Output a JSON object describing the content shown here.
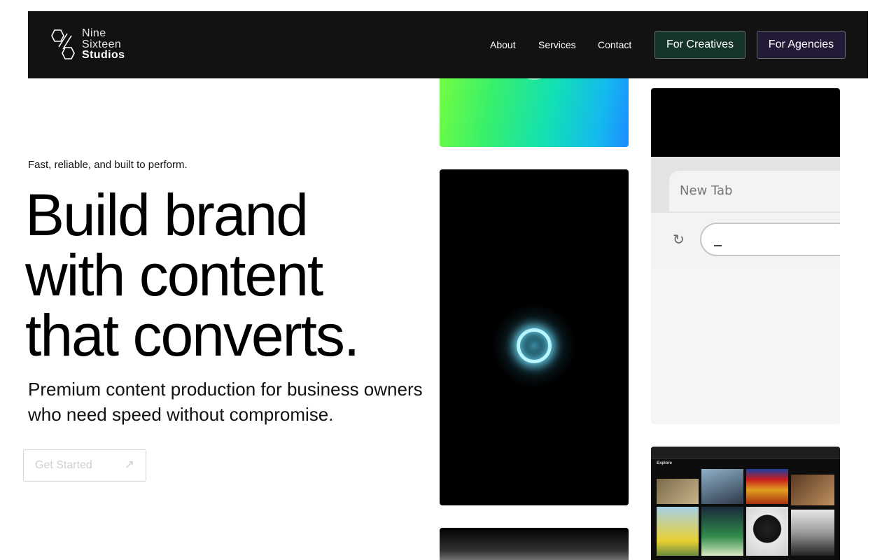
{
  "brand": {
    "logo_icon": "hexagon-logo-icon",
    "name_line1": "Nine",
    "name_line2": "Sixteen",
    "name_line3": "Studios"
  },
  "nav": {
    "links": [
      "About",
      "Services",
      "Contact"
    ],
    "creatives_button": "For Creatives",
    "agencies_button": "For Agencies",
    "creatives_color": "#15342c",
    "agencies_color": "#221a37",
    "background": "#121212"
  },
  "hero": {
    "tagline": "Fast, reliable, and built to perform.",
    "headline_line1": "Build brand",
    "headline_line2": "with content",
    "headline_line3": "that converts.",
    "subhead": "Premium content production for business owners who need speed without compromise.",
    "cta_label": "Get Started",
    "cta_icon": "arrow-up-right-icon"
  },
  "media": {
    "browser_tab_label": "New Tab",
    "reload_icon": "reload-icon",
    "explore_title": "Explore"
  }
}
